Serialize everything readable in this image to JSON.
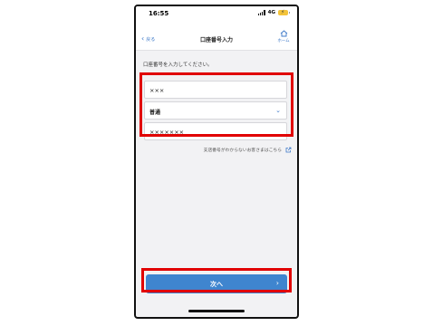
{
  "status_bar": {
    "time": "16:55",
    "network": "4G"
  },
  "nav": {
    "back_label": "戻る",
    "title": "口座番号入力",
    "home_label": "ホーム"
  },
  "form": {
    "instruction": "口座番号を入力してください。",
    "branch_value": "×××",
    "account_type_value": "普通",
    "account_number_value": "×××××××"
  },
  "help_link": {
    "text": "支店番号がわからないお客さまはこちら"
  },
  "next_button": {
    "label": "次へ"
  },
  "colors": {
    "highlight": "#e10000",
    "accent": "#3c78c8",
    "button": "#3f85cf",
    "battery": "#f3c33a"
  },
  "icons": [
    "chevron-left-icon",
    "home-icon",
    "chevron-down-icon",
    "external-link-icon",
    "chevron-right-icon",
    "signal-icon",
    "battery-icon"
  ]
}
